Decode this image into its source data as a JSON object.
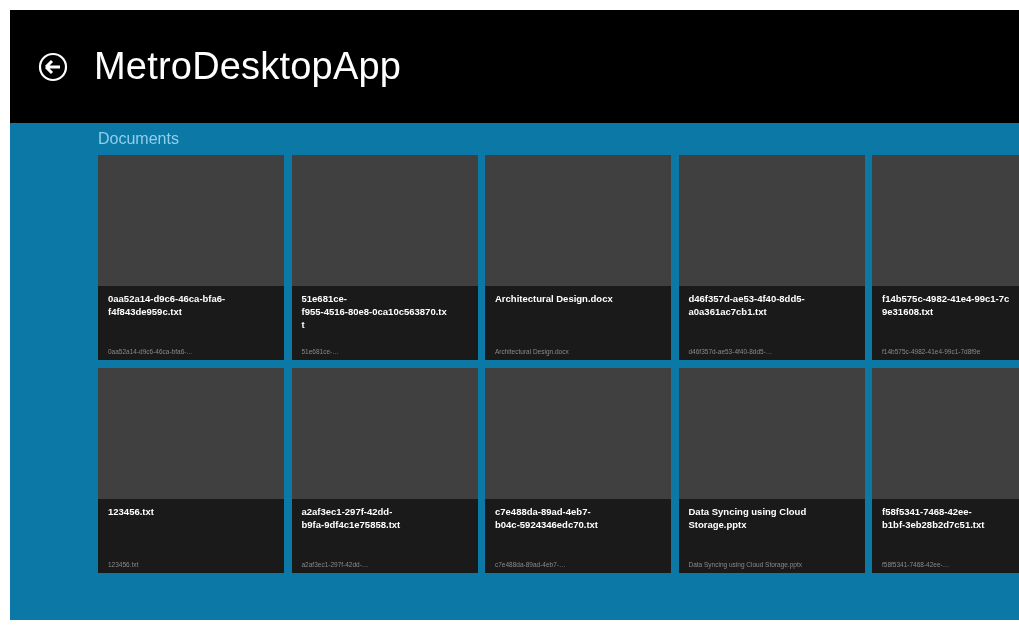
{
  "header": {
    "title": "MetroDesktopApp"
  },
  "section": {
    "title": "Documents"
  },
  "tiles": [
    [
      {
        "title_lines": [
          "0aa52a14-d9c6-46ca-bfa6-",
          "f4f843de959c.txt"
        ],
        "subtitle": "0aa52a14-d9c6-46ca-bfa6-…"
      },
      {
        "title_lines": [
          "51e681ce-",
          "f955-4516-80e8-0ca10c563870.tx",
          "t"
        ],
        "subtitle": "51e681ce-…"
      },
      {
        "title_lines": [
          "Architectural Design.docx"
        ],
        "subtitle": "Architectural Design.docx"
      },
      {
        "title_lines": [
          "d46f357d-ae53-4f40-8dd5-",
          "a0a361ac7cb1.txt"
        ],
        "subtitle": "d46f357d-ae53-4f40-8dd5-…"
      },
      {
        "title_lines": [
          "f14b575c-4982-41e4-99c1-7c",
          "9e31608.txt"
        ],
        "subtitle": "f14b575c-4982-41e4-99c1-7d8f9e"
      }
    ],
    [
      {
        "title_lines": [
          "123456.txt"
        ],
        "subtitle": "123456.txt"
      },
      {
        "title_lines": [
          "a2af3ec1-297f-42dd-",
          "b9fa-9df4c1e75858.txt"
        ],
        "subtitle": "a2af3ec1-297f-42dd-…"
      },
      {
        "title_lines": [
          "c7e488da-89ad-4eb7-",
          "b04c-5924346edc70.txt"
        ],
        "subtitle": "c7e488da-89ad-4eb7-…"
      },
      {
        "title_lines": [
          "Data Syncing using Cloud",
          "Storage.pptx"
        ],
        "subtitle": "Data Syncing using Cloud Storage.pptx"
      },
      {
        "title_lines": [
          "f58f5341-7468-42ee-",
          "b1bf-3eb28b2d7c51.txt"
        ],
        "subtitle": "f58f5341-7468-42ee-…"
      }
    ]
  ]
}
